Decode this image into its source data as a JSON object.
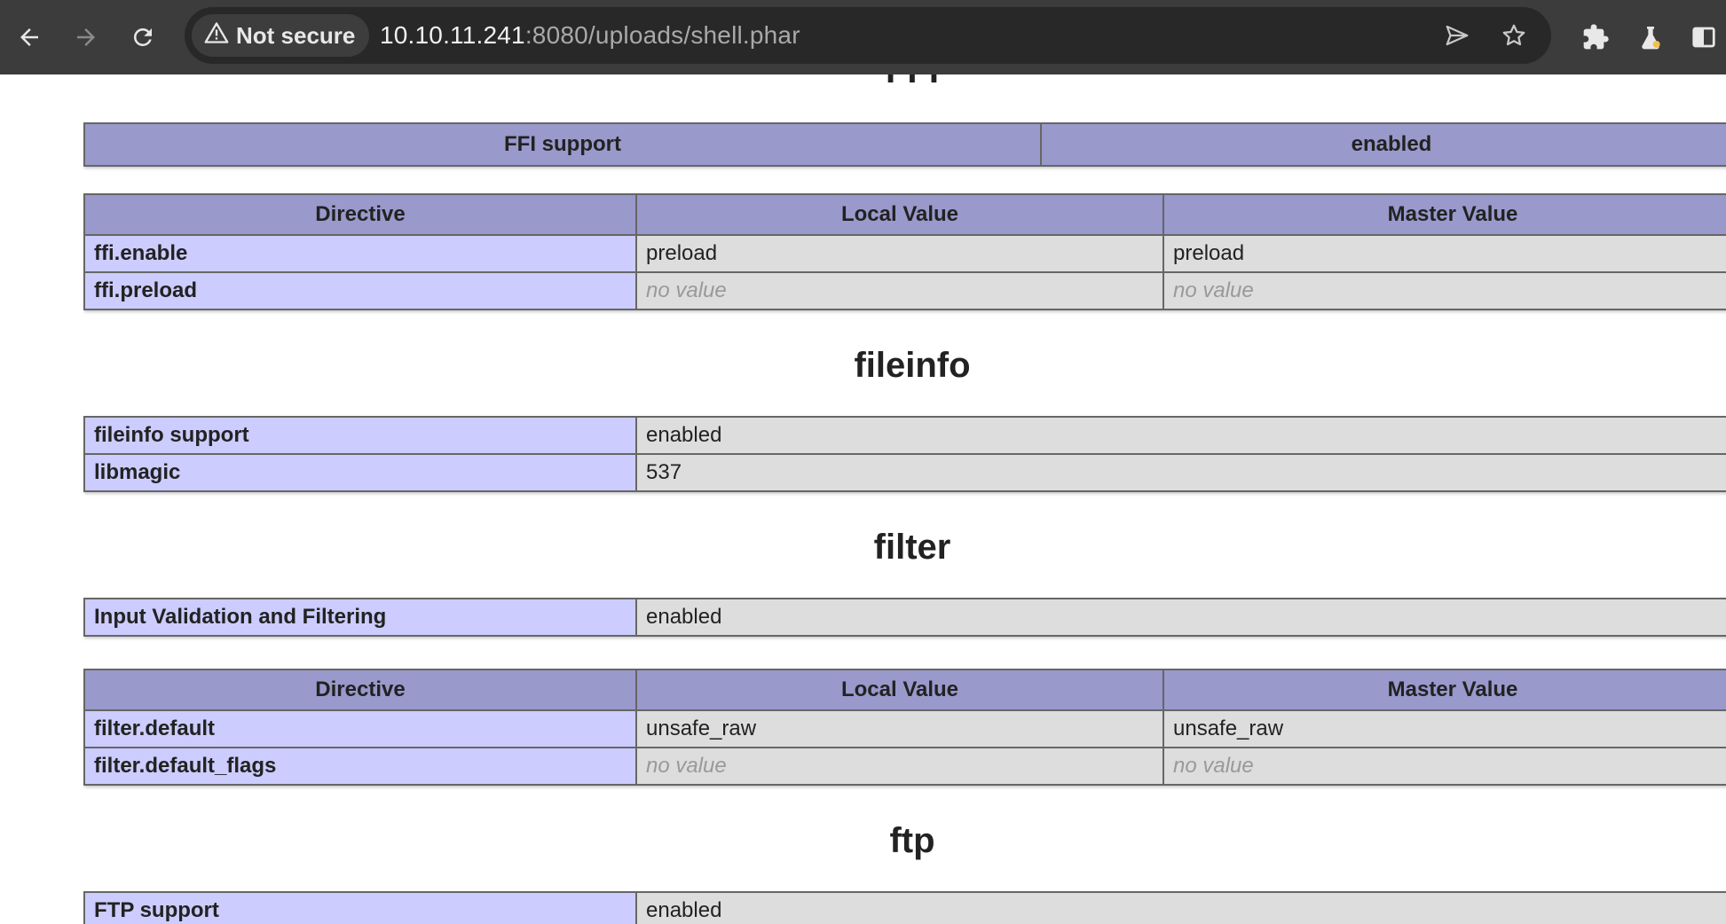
{
  "browser": {
    "security_label": "Not secure",
    "url_host": "10.10.11.241",
    "url_path": ":8080/uploads/shell.phar"
  },
  "ffi": {
    "heading": "FFI",
    "support_table": {
      "label": "FFI support",
      "value": "enabled"
    },
    "directive_headers": [
      "Directive",
      "Local Value",
      "Master Value"
    ],
    "directives": [
      {
        "name": "ffi.enable",
        "local": "preload",
        "master": "preload",
        "no_value": false
      },
      {
        "name": "ffi.preload",
        "local": "no value",
        "master": "no value",
        "no_value": true
      }
    ]
  },
  "fileinfo": {
    "heading": "fileinfo",
    "rows": [
      {
        "name": "fileinfo support",
        "value": "enabled"
      },
      {
        "name": "libmagic",
        "value": "537"
      }
    ]
  },
  "filter": {
    "heading": "filter",
    "rows": [
      {
        "name": "Input Validation and Filtering",
        "value": "enabled"
      }
    ],
    "directive_headers": [
      "Directive",
      "Local Value",
      "Master Value"
    ],
    "directives": [
      {
        "name": "filter.default",
        "local": "unsafe_raw",
        "master": "unsafe_raw",
        "no_value": false
      },
      {
        "name": "filter.default_flags",
        "local": "no value",
        "master": "no value",
        "no_value": true
      }
    ]
  },
  "ftp": {
    "heading": "ftp",
    "rows": [
      {
        "name": "FTP support",
        "value": "enabled"
      }
    ]
  },
  "icons": [
    "back-icon",
    "forward-icon",
    "reload-icon",
    "warning-icon",
    "send-icon",
    "star-icon",
    "extensions-icon",
    "labs-icon",
    "side-panel-icon"
  ],
  "colors": {
    "header_bg": "#9999cc",
    "label_bg": "#ccccff",
    "value_bg": "#dddddd",
    "toolbar_bg": "#3c3c3c"
  }
}
